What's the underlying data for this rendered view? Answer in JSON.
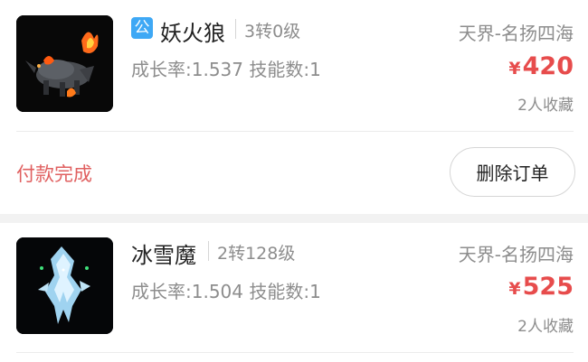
{
  "orders": [
    {
      "badge": "公",
      "name": "妖火狼",
      "tier": "3转0级",
      "stats": "成长率:1.537 技能数:1",
      "server": "天界-名扬四海",
      "currency": "¥",
      "price": "420",
      "favorites": "2人收藏",
      "status": "付款完成",
      "action_label": "删除订单"
    },
    {
      "name": "冰雪魔",
      "tier": "2转128级",
      "stats": "成长率:1.504 技能数:1",
      "server": "天界-名扬四海",
      "currency": "¥",
      "price": "525",
      "favorites": "2人收藏"
    }
  ],
  "colors": {
    "price": "#e74c4c",
    "status": "#e06060",
    "badge": "#3ea8f5",
    "section_gap": "#f2f2f2"
  }
}
